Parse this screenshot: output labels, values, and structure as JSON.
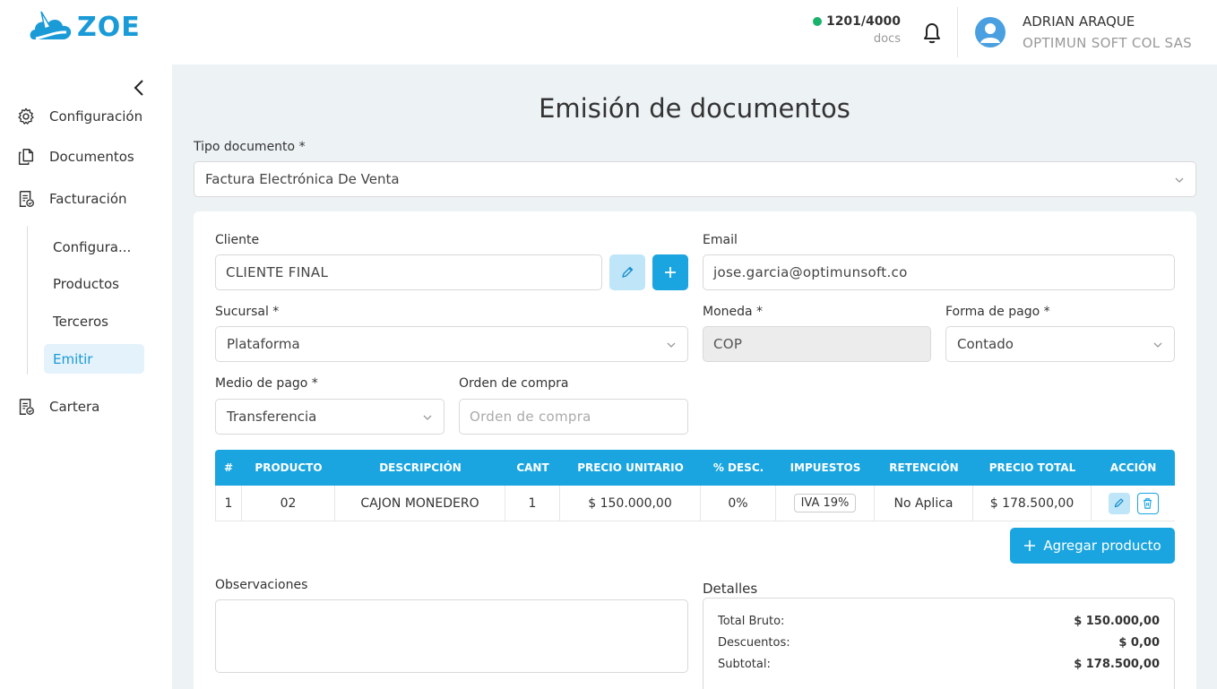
{
  "header": {
    "logo_text": "ZOE",
    "doc_count": "1201/4000",
    "doc_label": "docs",
    "user_name": "ADRIAN ARAQUE",
    "company": "OPTIMUN SOFT COL SAS",
    "status_color": "#19b26b"
  },
  "sidebar": {
    "items": [
      {
        "label": "Configuración",
        "icon": "gear-icon"
      },
      {
        "label": "Documentos",
        "icon": "documents-icon"
      },
      {
        "label": "Facturación",
        "icon": "invoice-icon"
      },
      {
        "label": "Cartera",
        "icon": "wallet-doc-icon"
      }
    ],
    "sub_items": [
      {
        "label": "Configura..."
      },
      {
        "label": "Productos"
      },
      {
        "label": "Terceros"
      },
      {
        "label": "Emitir",
        "active": true
      }
    ]
  },
  "main": {
    "title": "Emisión de documentos",
    "tipo_documento": {
      "label": "Tipo documento *",
      "value": "Factura Electrónica De Venta"
    },
    "cliente": {
      "label": "Cliente",
      "value": "CLIENTE FINAL"
    },
    "email": {
      "label": "Email",
      "value": "jose.garcia@optimunsoft.co"
    },
    "sucursal": {
      "label": "Sucursal *",
      "value": "Plataforma"
    },
    "moneda": {
      "label": "Moneda *",
      "value": "COP"
    },
    "forma_pago": {
      "label": "Forma de pago *",
      "value": "Contado"
    },
    "medio_pago": {
      "label": "Medio de pago *",
      "value": "Transferencia"
    },
    "orden_compra": {
      "label": "Orden de compra",
      "placeholder": "Orden de compra"
    },
    "table": {
      "headers": [
        "#",
        "PRODUCTO",
        "DESCRIPCIÓN",
        "CANT",
        "PRECIO UNITARIO",
        "% DESC.",
        "IMPUESTOS",
        "RETENCIÓN",
        "PRECIO TOTAL",
        "ACCIÓN"
      ],
      "rows": [
        {
          "num": "1",
          "producto": "02",
          "descripcion": "CAJON MONEDERO",
          "cant": "1",
          "precio_unitario": "$ 150.000,00",
          "desc": "0%",
          "impuestos": "IVA 19%",
          "retencion": "No Aplica",
          "precio_total": "$ 178.500,00"
        }
      ]
    },
    "add_product_label": "Agregar producto",
    "observaciones_label": "Observaciones",
    "details": {
      "title": "Detalles",
      "rows": [
        {
          "label": "Total Bruto:",
          "value": "$ 150.000,00"
        },
        {
          "label": "Descuentos:",
          "value": "$ 0,00"
        },
        {
          "label": "Subtotal:",
          "value": "$ 178.500,00"
        }
      ]
    }
  },
  "colors": {
    "accent": "#1aa5e0",
    "main_bg": "#edf2f4",
    "active_bg": "#e3f2fb"
  }
}
